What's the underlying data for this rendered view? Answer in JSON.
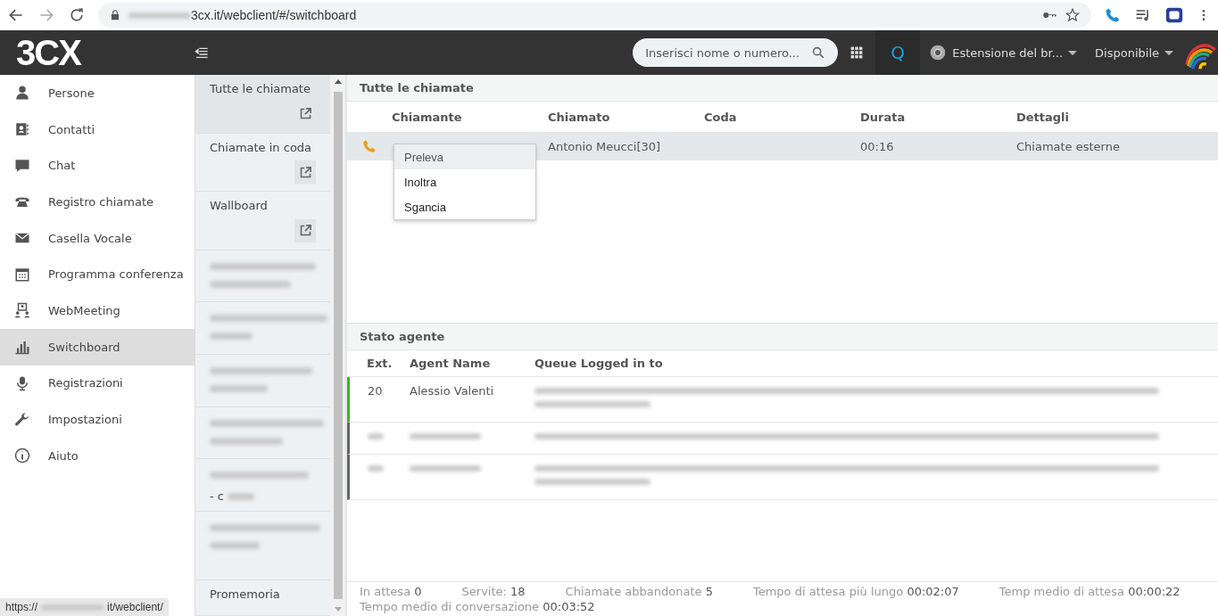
{
  "browser": {
    "url": "3cx.it/webclient/#/switchboard",
    "status_url_start": "https://",
    "status_url_end": "it/webclient/"
  },
  "header": {
    "logo": "3CX",
    "search": {
      "placeholder": "Inserisci nome o numero..."
    },
    "q_label": "Q",
    "extension": "Estensione del br...",
    "status": "Disponibile"
  },
  "sidebar": {
    "items": [
      {
        "label": "Persone",
        "selected": false
      },
      {
        "label": "Contatti",
        "selected": false
      },
      {
        "label": "Chat",
        "selected": false
      },
      {
        "label": "Registro chiamate",
        "selected": false
      },
      {
        "label": "Casella Vocale",
        "selected": false
      },
      {
        "label": "Programma conferenza",
        "selected": false
      },
      {
        "label": "WebMeeting",
        "selected": false
      },
      {
        "label": "Switchboard",
        "selected": true
      },
      {
        "label": "Registrazioni",
        "selected": false
      },
      {
        "label": "Impostazioni",
        "selected": false
      },
      {
        "label": "Aiuto",
        "selected": false
      }
    ]
  },
  "views": {
    "items": [
      {
        "kind": "view",
        "label": "Tutte le chiamate",
        "selected": true,
        "popout": true
      },
      {
        "kind": "view",
        "label": "Chiamate in coda",
        "selected": false,
        "popout": true
      },
      {
        "kind": "view",
        "label": "Wallboard",
        "selected": false,
        "popout": true
      },
      {
        "kind": "blurred"
      },
      {
        "kind": "blurred"
      },
      {
        "kind": "blurred"
      },
      {
        "kind": "blurred"
      },
      {
        "kind": "blurred",
        "visible_text": "- c"
      },
      {
        "kind": "blurred"
      },
      {
        "kind": "view",
        "label": "Promemoria",
        "selected": false,
        "popout": false
      }
    ]
  },
  "calls": {
    "title": "Tutte le chiamate",
    "columns": [
      "Chiamante",
      "Chiamato",
      "Coda",
      "Durata",
      "Dettagli"
    ],
    "rows": [
      {
        "callee": "Antonio Meucci[30]",
        "duration": "00:16",
        "details": "Chiamate esterne",
        "selected": true
      }
    ],
    "context_menu": [
      {
        "label": "Preleva",
        "selected": true
      },
      {
        "label": "Inoltra",
        "selected": false
      },
      {
        "label": "Sgancia",
        "selected": false
      }
    ]
  },
  "agents": {
    "title": "Stato agente",
    "columns": [
      "Ext.",
      "Agent Name",
      "Queue Logged in to"
    ],
    "rows": [
      {
        "ext": "20",
        "name": "Alessio Valenti",
        "color": "#3cb521"
      },
      {
        "color": "#666666"
      },
      {
        "color": "#666666"
      }
    ]
  },
  "stats": [
    {
      "label": "In attesa",
      "value": "0"
    },
    {
      "label": "Servite:",
      "value": "18"
    },
    {
      "label": "Chiamate abbandonate",
      "value": "5"
    },
    {
      "label": "Tempo di attesa più lungo",
      "value": "00:02:07"
    },
    {
      "label": "Temp medio di attesa",
      "value": "00:00:22"
    },
    {
      "label": "Tempo medio di conversazione",
      "value": "00:03:52"
    }
  ]
}
